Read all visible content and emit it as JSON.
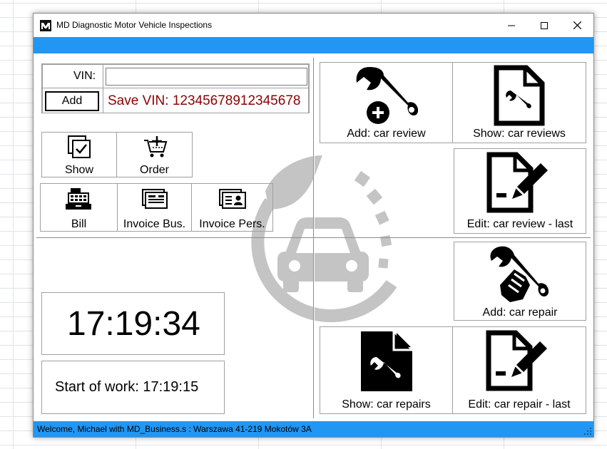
{
  "window": {
    "title": "MD Diagnostic Motor Vehicle Inspections",
    "controls": {
      "minimize": "–",
      "maximize": "☐",
      "close": "✕"
    }
  },
  "vin": {
    "label": "VIN:",
    "value": "",
    "add_label": "Add",
    "saved_text": "Save VIN: 12345678912345678"
  },
  "left_buttons": {
    "show": "Show",
    "order": "Order",
    "bill": "Bill",
    "invoice_bus": "Invoice Bus.",
    "invoice_pers": "Invoice Pers."
  },
  "clock": {
    "time": "17:19:34",
    "start_text": "Start of work: 17:19:15"
  },
  "actions": {
    "add_review": "Add: car review",
    "show_reviews": "Show: car reviews",
    "edit_review_last": "Edit: car review - last",
    "add_repair": "Add: car repair",
    "show_repairs": "Show: car repairs",
    "edit_repair_last": "Edit: car repair - last"
  },
  "status": {
    "text": "Welcome, Michael with MD_Business.s : Warszawa 41-219 Mokotów 3A"
  },
  "colors": {
    "accent_blue": "#2196f3",
    "vin_text": "#8b0000",
    "logo_gray": "#c4c4c4"
  },
  "icons": {
    "app": "md-logo-icon",
    "add_review": "wrench-plus-icon",
    "show_reviews": "document-wrench-icon",
    "edit_review": "document-pencil-icon",
    "add_repair": "hand-wrench-icon",
    "show_repairs": "document-wrench-filled-icon",
    "edit_repair": "document-pencil-icon"
  }
}
